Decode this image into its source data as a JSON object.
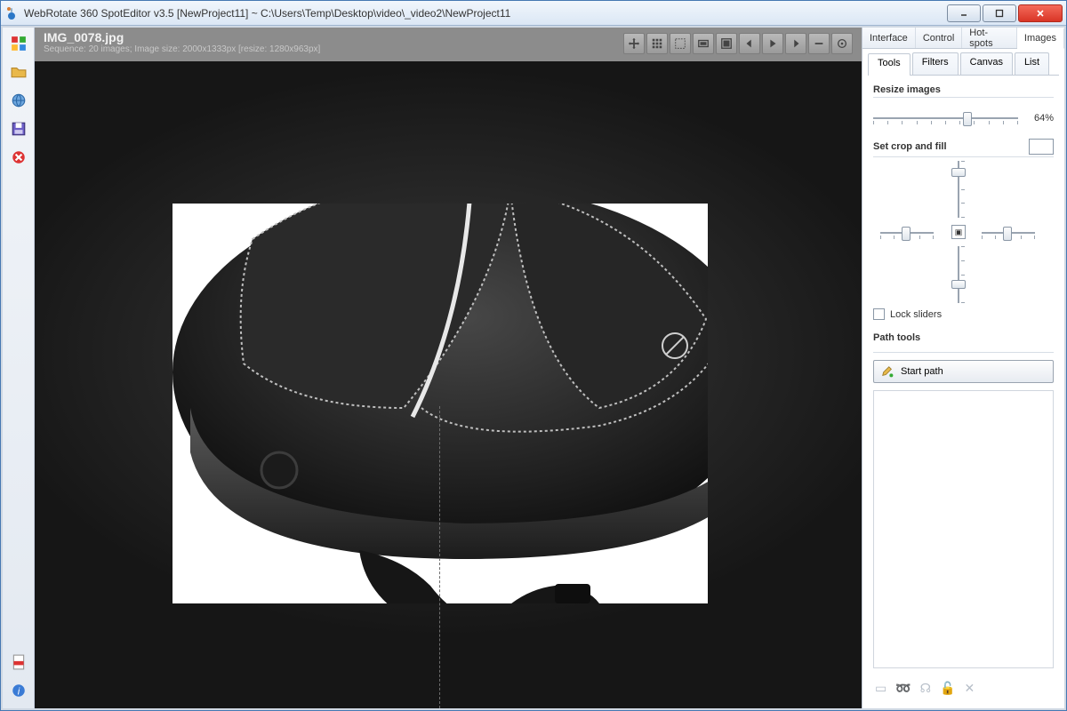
{
  "window": {
    "title": "WebRotate 360 SpotEditor v3.5 [NewProject11] ~ C:\\Users\\Temp\\Desktop\\video\\_video2\\NewProject11"
  },
  "leftbar": {
    "icons": [
      "palette",
      "folder",
      "globe",
      "save",
      "close",
      "pdf",
      "info"
    ]
  },
  "editor": {
    "filename": "IMG_0078.jpg",
    "sequence_info": "Sequence: 20 images; Image size: 2000x1333px [resize: 1280x963px]"
  },
  "toptabs": {
    "items": [
      "Interface",
      "Control",
      "Hot-spots",
      "Images"
    ],
    "active": "Images"
  },
  "subtabs": {
    "items": [
      "Tools",
      "Filters",
      "Canvas",
      "List"
    ],
    "active": "Tools"
  },
  "panel": {
    "resize": {
      "title": "Resize images",
      "value": "64%"
    },
    "crop": {
      "title": "Set crop and fill",
      "lock_label": "Lock sliders"
    },
    "path": {
      "title": "Path tools",
      "start_label": "Start path"
    }
  }
}
